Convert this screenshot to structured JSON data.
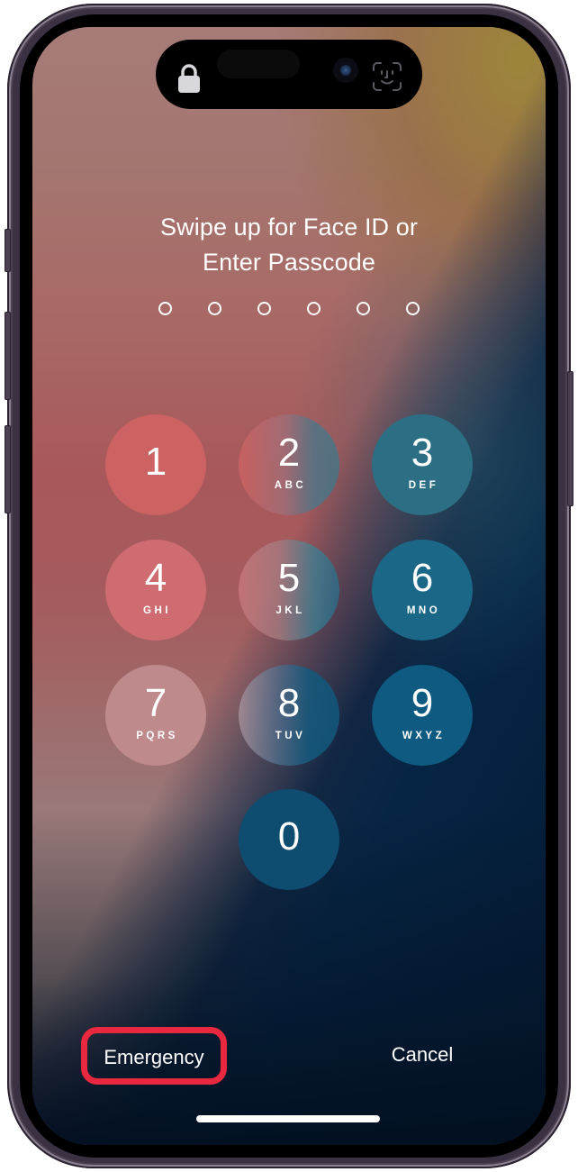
{
  "screen": {
    "prompt_line1": "Swipe up for Face ID or",
    "prompt_line2": "Enter Passcode",
    "passcode_length": 6,
    "entered_digits": 0
  },
  "island": {
    "left_icon": "lock-icon",
    "right_icon": "face-id-icon"
  },
  "keypad": [
    {
      "digit": "1",
      "letters": ""
    },
    {
      "digit": "2",
      "letters": "ABC"
    },
    {
      "digit": "3",
      "letters": "DEF"
    },
    {
      "digit": "4",
      "letters": "GHI"
    },
    {
      "digit": "5",
      "letters": "JKL"
    },
    {
      "digit": "6",
      "letters": "MNO"
    },
    {
      "digit": "7",
      "letters": "PQRS"
    },
    {
      "digit": "8",
      "letters": "TUV"
    },
    {
      "digit": "9",
      "letters": "WXYZ"
    },
    {
      "digit": "0",
      "letters": ""
    }
  ],
  "bottom": {
    "emergency_label": "Emergency",
    "cancel_label": "Cancel",
    "highlight_color": "#e8283e"
  }
}
